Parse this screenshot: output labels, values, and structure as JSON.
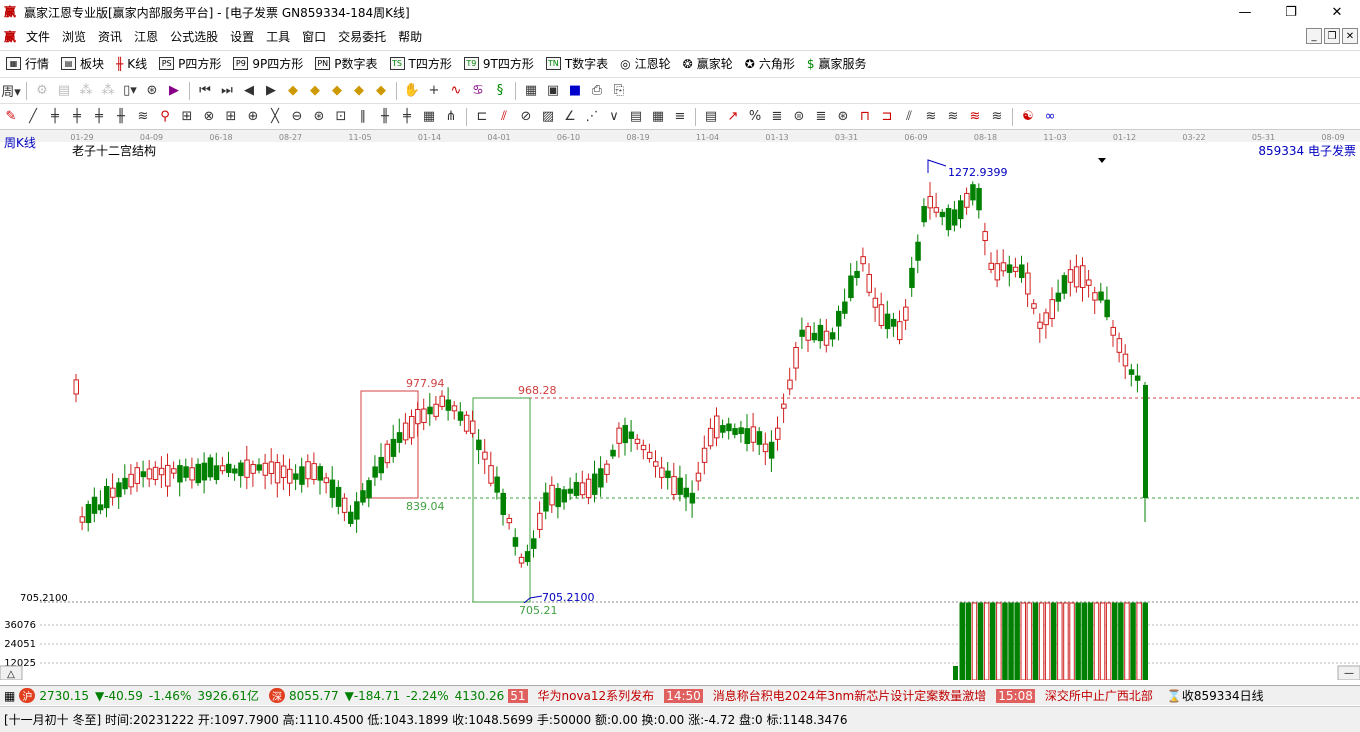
{
  "window": {
    "title": "赢家江恩专业版[赢家内部服务平台] - [电子发票  GN859334-184周K线]",
    "logo": "赢"
  },
  "menu": [
    "文件",
    "浏览",
    "资讯",
    "江恩",
    "公式选股",
    "设置",
    "工具",
    "窗口",
    "交易委托",
    "帮助"
  ],
  "toolbar1": [
    {
      "label": "行情",
      "icon": "grid-icon"
    },
    {
      "label": "板块",
      "icon": "board-icon"
    },
    {
      "label": "K线",
      "icon": "kline-icon"
    },
    {
      "label": "P四方形",
      "icon": "ps-icon",
      "code": "PS"
    },
    {
      "label": "9P四方形",
      "icon": "p9-icon",
      "code": "P9"
    },
    {
      "label": "P数字表",
      "icon": "pn-icon",
      "code": "PN"
    },
    {
      "label": "T四方形",
      "icon": "ts-icon",
      "code": "TS"
    },
    {
      "label": "9T四方形",
      "icon": "t9-icon",
      "code": "T9"
    },
    {
      "label": "T数字表",
      "icon": "tn-icon",
      "code": "TN"
    },
    {
      "label": "江恩轮",
      "icon": "gann-wheel-icon"
    },
    {
      "label": "赢家轮",
      "icon": "winner-wheel-icon"
    },
    {
      "label": "六角形",
      "icon": "hexagon-icon"
    },
    {
      "label": "赢家服务",
      "icon": "dollar-icon"
    }
  ],
  "chart": {
    "period_label": "周K线",
    "indicator_label": "老子十二宫结构",
    "stock_label": "859334 电子发票",
    "date_ticks": [
      "01-29",
      "04-09",
      "06-18",
      "08-27",
      "11-05",
      "01-14",
      "04-01",
      "06-10",
      "08-19",
      "11-04",
      "01-13",
      "03-31",
      "06-09",
      "08-18",
      "11-03",
      "01-12",
      "03-22",
      "05-31",
      "08-09"
    ],
    "high_label": "1272.9399",
    "low_label": "705.2100",
    "low_value_left": "705.2100",
    "box1_high": "977.94",
    "box1_low": "839.04",
    "level_high": "968.28",
    "level_low": "705.21",
    "volume_ticks": [
      "36076",
      "24051",
      "12025"
    ]
  },
  "chart_data": {
    "type": "candlestick",
    "title": "老子十二宫结构",
    "ylim": [
      705.21,
      1272.9399
    ],
    "volume_ticks": [
      12025,
      24051,
      36076
    ],
    "horizontal_levels": [
      968.28,
      839.04
    ]
  },
  "status": {
    "sh_index": "2730.15",
    "sh_change": "▼-40.59",
    "sh_pct": "-1.46%",
    "sh_amount": "3926.61亿",
    "sz_index": "8055.77",
    "sz_change": "▼-184.71",
    "sz_pct": "-2.24%",
    "sz_amount": "4130.26",
    "news": [
      {
        "time": "51",
        "text": "华为nova12系列发布"
      },
      {
        "time": "14:50",
        "text": "消息称台积电2024年3nm新芯片设计定案数量激增"
      },
      {
        "time": "15:08",
        "text": "深交所中止广西北部"
      }
    ],
    "right_text": "收859334日线"
  },
  "info": "[十一月初十 冬至] 时间:20231222 开:1097.7900 高:1110.4500 低:1043.1899 收:1048.5699 手:50000 额:0.00 换:0.00 涨:-4.72 盘:0 标:1148.3476"
}
